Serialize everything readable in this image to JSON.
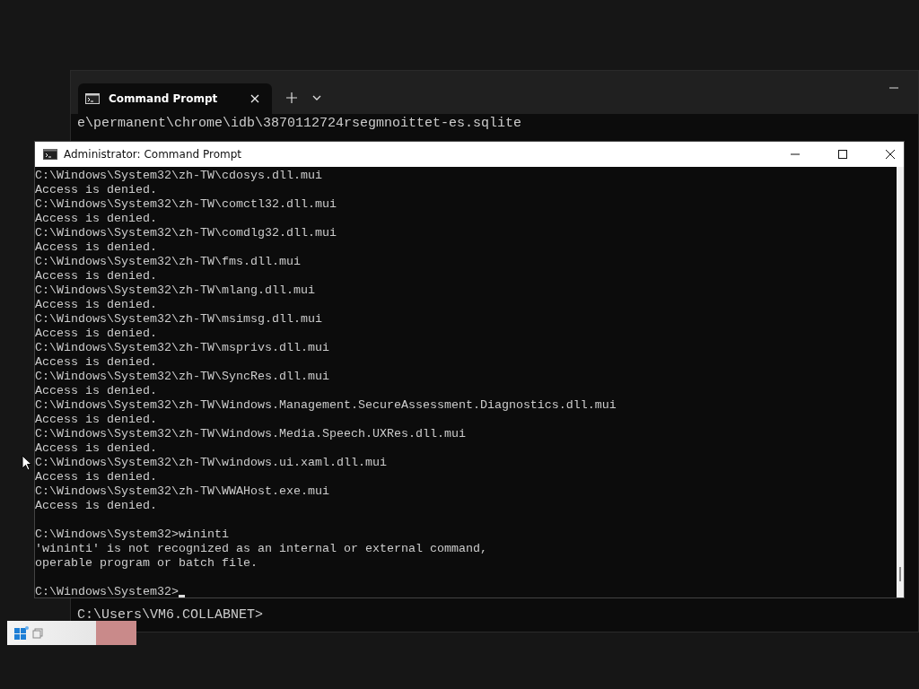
{
  "terminal_window": {
    "tab": {
      "title": "Command Prompt",
      "selected": true
    },
    "output_lines": [
      "e\\permanent\\chrome\\idb\\3870112724rsegmnoittet-es.sqlite"
    ],
    "prompt": "C:\\Users\\VM6.COLLABNET>"
  },
  "admin_window": {
    "title": "Administrator: Command Prompt",
    "blocks": [
      [
        "C:\\Windows\\System32\\zh-TW\\cdosys.dll.mui",
        "Access is denied.",
        "C:\\Windows\\System32\\zh-TW\\comctl32.dll.mui",
        "Access is denied.",
        "C:\\Windows\\System32\\zh-TW\\comdlg32.dll.mui",
        "Access is denied.",
        "C:\\Windows\\System32\\zh-TW\\fms.dll.mui",
        "Access is denied.",
        "C:\\Windows\\System32\\zh-TW\\mlang.dll.mui",
        "Access is denied.",
        "C:\\Windows\\System32\\zh-TW\\msimsg.dll.mui",
        "Access is denied.",
        "C:\\Windows\\System32\\zh-TW\\msprivs.dll.mui",
        "Access is denied.",
        "C:\\Windows\\System32\\zh-TW\\SyncRes.dll.mui",
        "Access is denied.",
        "C:\\Windows\\System32\\zh-TW\\Windows.Management.SecureAssessment.Diagnostics.dll.mui",
        "Access is denied.",
        "C:\\Windows\\System32\\zh-TW\\Windows.Media.Speech.UXRes.dll.mui",
        "Access is denied.",
        "C:\\Windows\\System32\\zh-TW\\windows.ui.xaml.dll.mui",
        "Access is denied.",
        "C:\\Windows\\System32\\zh-TW\\WWAHost.exe.mui",
        "Access is denied."
      ],
      [
        "C:\\Windows\\System32>wininti",
        "'wininti' is not recognized as an internal or external command,",
        "operable program or batch file."
      ],
      [
        "C:\\Windows\\System32>"
      ]
    ]
  }
}
